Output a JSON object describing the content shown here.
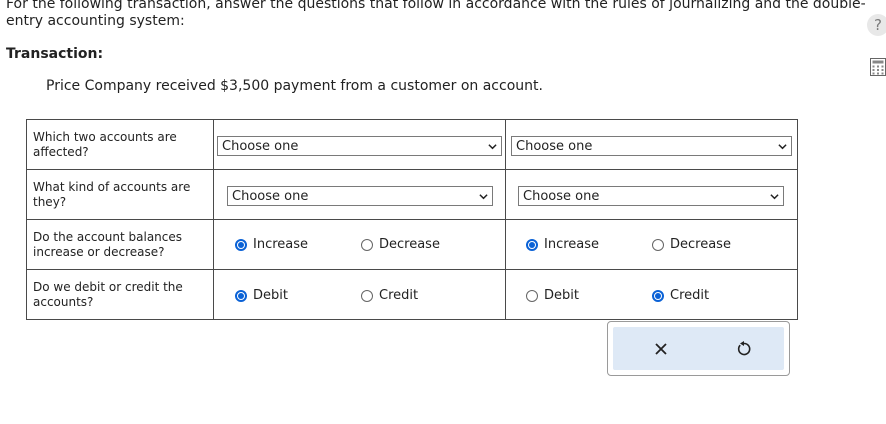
{
  "instructions": "For the following transaction, answer the questions that follow in accordance with the rules of journalizing and the double-entry accounting system:",
  "transaction_heading": "Transaction:",
  "transaction_text": "Price Company received $3,500 payment from a customer on account.",
  "rows": [
    {
      "question": "Which two accounts are affected?",
      "col1": {
        "select": "Choose one"
      },
      "col2": {
        "select": "Choose one"
      }
    },
    {
      "question": "What kind of accounts are they?",
      "col1": {
        "select": "Choose one"
      },
      "col2": {
        "select": "Choose one"
      }
    },
    {
      "question": "Do the account balances increase or decrease?",
      "col1": {
        "option_a": "Increase",
        "option_b": "Decrease",
        "selected": "Increase"
      },
      "col2": {
        "option_a": "Increase",
        "option_b": "Decrease",
        "selected": "Increase"
      }
    },
    {
      "question": "Do we debit or credit the accounts?",
      "col1": {
        "option_a": "Debit",
        "option_b": "Credit",
        "selected": "Debit"
      },
      "col2": {
        "option_a": "Debit",
        "option_b": "Credit",
        "selected": "Credit"
      }
    }
  ],
  "icons": {
    "help": "?",
    "clear": "close-icon",
    "reset": "reset-icon",
    "calculator": "calculator-icon"
  },
  "colors": {
    "radio_selected": "#0b62d6",
    "action_bg": "#dee9f6"
  }
}
